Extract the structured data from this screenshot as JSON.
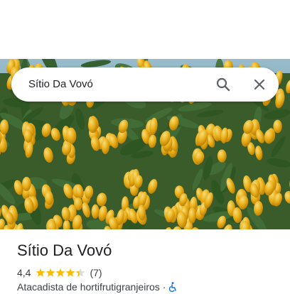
{
  "search": {
    "query": "Sítio Da Vovó",
    "search_icon": "search-icon",
    "close_icon": "close-icon"
  },
  "hero_image": {
    "subject": "mango-tree-photo"
  },
  "place": {
    "name": "Sítio Da Vovó",
    "rating": "4,4",
    "stars": 4.4,
    "reviews": "(7)",
    "category": "Atacadista de hortifrutigranjeiros",
    "separator": "·",
    "accessibility_icon": "wheelchair-icon"
  },
  "colors": {
    "star": "#fbbc04",
    "star_empty": "#dadce0",
    "accessibility": "#1a73e8",
    "text": "#202124",
    "subtext": "#3c4043"
  }
}
